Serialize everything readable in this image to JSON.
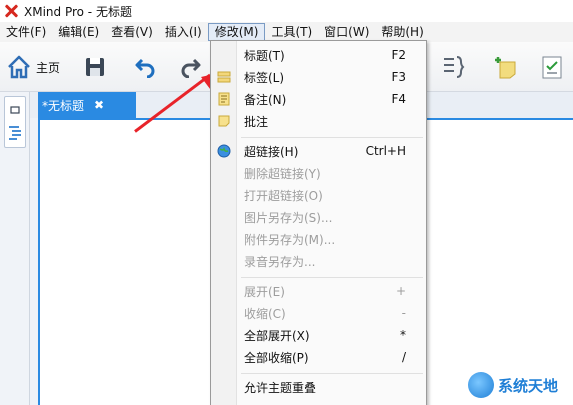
{
  "window": {
    "title": "XMind Pro - 无标题"
  },
  "menubar": {
    "items": [
      "文件(F)",
      "编辑(E)",
      "查看(V)",
      "插入(I)",
      "修改(M)",
      "工具(T)",
      "窗口(W)",
      "帮助(H)"
    ]
  },
  "toolbar": {
    "home_label": "主页"
  },
  "tabs": {
    "doc_title": "*无标题",
    "close_glyph": "✖"
  },
  "dropdown": {
    "items": [
      {
        "label": "标题(T)",
        "shortcut": "F2"
      },
      {
        "label": "标签(L)",
        "shortcut": "F3"
      },
      {
        "label": "备注(N)",
        "shortcut": "F4"
      },
      {
        "label": "批注",
        "shortcut": ""
      },
      {
        "label": "超链接(H)",
        "shortcut": "Ctrl+H"
      },
      {
        "label": "删除超链接(Y)",
        "shortcut": ""
      },
      {
        "label": "打开超链接(O)",
        "shortcut": ""
      },
      {
        "label": "图片另存为(S)...",
        "shortcut": ""
      },
      {
        "label": "附件另存为(M)...",
        "shortcut": ""
      },
      {
        "label": "录音另存为...",
        "shortcut": ""
      },
      {
        "label": "展开(E)",
        "shortcut": "+"
      },
      {
        "label": "收缩(C)",
        "shortcut": "-"
      },
      {
        "label": "全部展开(X)",
        "shortcut": "*"
      },
      {
        "label": "全部收缩(P)",
        "shortcut": "/"
      },
      {
        "label": "允许主题重叠",
        "shortcut": ""
      }
    ]
  },
  "watermark": {
    "text": "系统天地"
  },
  "colors": {
    "accent": "#2a8ae2",
    "arrow": "#e8232a",
    "brand": "#d6281f"
  }
}
